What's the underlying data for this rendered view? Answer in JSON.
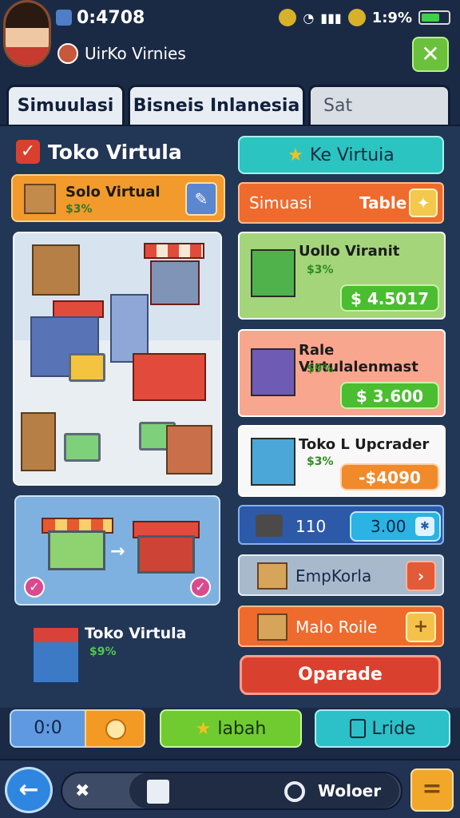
{
  "status": {
    "time": "0:4708",
    "battery": "1:9%",
    "battery_level": 0.7
  },
  "user": {
    "name": "UirKo Virnies"
  },
  "tabs": [
    {
      "label": "Simuulasi"
    },
    {
      "label": "Bisneis Inlanesia"
    },
    {
      "label": "Sat"
    }
  ],
  "left": {
    "title": "Toko Virtula",
    "featured": {
      "title": "Solo Virtual",
      "percent": "$3%"
    },
    "bottom_item": {
      "title": "Toko Virtula",
      "percent": "$9%"
    }
  },
  "right": {
    "top_button": "Ke Virtuia",
    "sim_bar": {
      "left": "Simuasi",
      "right": "Table"
    },
    "cards": [
      {
        "name": "Uollo Viranit",
        "pct": "$3%",
        "price": "$ 4.5017",
        "color": "#4bbd30"
      },
      {
        "name": "Rale Virtulalenmast",
        "pct": "$9%",
        "price": "$ 3.600",
        "color": "#4bbd30"
      },
      {
        "name": "Toko L Upcrader",
        "pct": "$3%",
        "price": "-$4090",
        "color": "#f08a2b"
      }
    ],
    "row_blue": {
      "num": "110",
      "pill": "3.00"
    },
    "row_gray": {
      "label": "EmpKorla"
    },
    "row_orange": {
      "label": "Malo Roile"
    },
    "upgrade": "Oparade"
  },
  "actions": {
    "score": "0:0",
    "green": "labah",
    "teal": "Lride"
  },
  "nav": {
    "label": "Woloer"
  },
  "colors": {
    "background": "#1b2a44",
    "accent_green": "#6fcb2f",
    "accent_orange": "#f39a25",
    "accent_teal": "#2cc0c8",
    "danger": "#d9412e"
  },
  "icons": [
    "back-arrow-icon",
    "wrench-icon",
    "cube-icon",
    "gear-icon",
    "menu-icon",
    "close-icon",
    "star-icon",
    "checkbox-icon"
  ]
}
